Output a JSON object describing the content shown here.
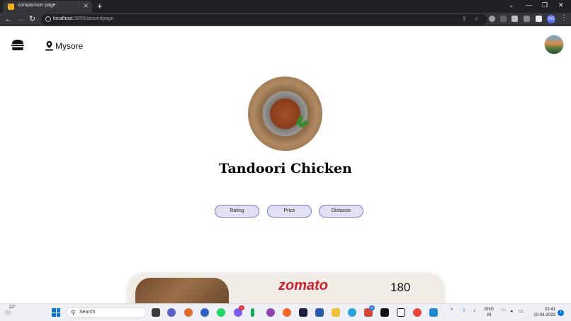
{
  "browser": {
    "tab_title": "comparison page",
    "url_host": "localhost",
    "url_path": ":3000/secondpage",
    "profile_initials": "SG"
  },
  "header": {
    "location": "Mysore"
  },
  "dish": {
    "name": "Tandoori Chicken"
  },
  "sort_buttons": [
    "Rating",
    "Price",
    "Distance"
  ],
  "results": [
    {
      "brand": "zomato",
      "price": "180",
      "brand_color": "#cb202d"
    }
  ],
  "taskbar": {
    "temperature": "22°",
    "search_label": "Search",
    "badge_messenger": "9",
    "badge_mail": "29",
    "lang_line1": "ENG",
    "lang_line2": "IN",
    "time": "03:41",
    "date": "10-04-2023",
    "notifications": "1"
  },
  "colors": {
    "sort_button_bg": "#e2e0f4",
    "sort_button_border": "#7b7acc",
    "card_bg": "#f1ece6",
    "accent_windows": "#0a74d9"
  }
}
